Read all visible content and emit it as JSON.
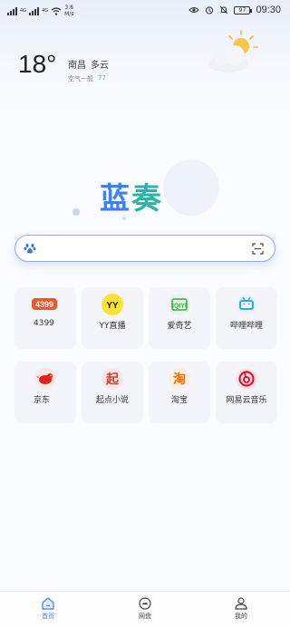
{
  "status_bar": {
    "signal1": "4G",
    "signal2": "4G",
    "net_speed_value": "3.6",
    "net_speed_unit": "M/s",
    "battery": "97",
    "time": "09:30"
  },
  "weather": {
    "temperature": "18°",
    "city": "南昌",
    "condition": "多云",
    "air_label": "空气一般",
    "air_value": "77"
  },
  "logo": {
    "char1": "蓝",
    "char2": "奏"
  },
  "search": {
    "placeholder": "",
    "value": ""
  },
  "apps": [
    {
      "label": "4399",
      "icon": "4399-icon",
      "color": "#f0562a"
    },
    {
      "label": "YY直播",
      "icon": "yy-live-icon",
      "color": "#ffe033"
    },
    {
      "label": "爱奇艺",
      "icon": "iqiyi-icon",
      "color": "#2ab33f"
    },
    {
      "label": "哔哩哔哩",
      "icon": "bilibili-icon",
      "color": "#23aee5"
    },
    {
      "label": "京东",
      "icon": "jd-icon",
      "color": "#e2231a"
    },
    {
      "label": "起点小说",
      "icon": "qidian-icon",
      "color": "#d43c33"
    },
    {
      "label": "淘宝",
      "icon": "taobao-icon",
      "color": "#ff6a00"
    },
    {
      "label": "网易云音乐",
      "icon": "netease-music-icon",
      "color": "#e60026"
    }
  ],
  "tabs": [
    {
      "label": "首页",
      "icon": "home-icon",
      "active": true
    },
    {
      "label": "网盘",
      "icon": "cloud-drive-icon",
      "active": false
    },
    {
      "label": "我的",
      "icon": "profile-icon",
      "active": false
    }
  ],
  "colors": {
    "accent": "#3f7ff2",
    "logo_teal": "#29b3a9"
  }
}
